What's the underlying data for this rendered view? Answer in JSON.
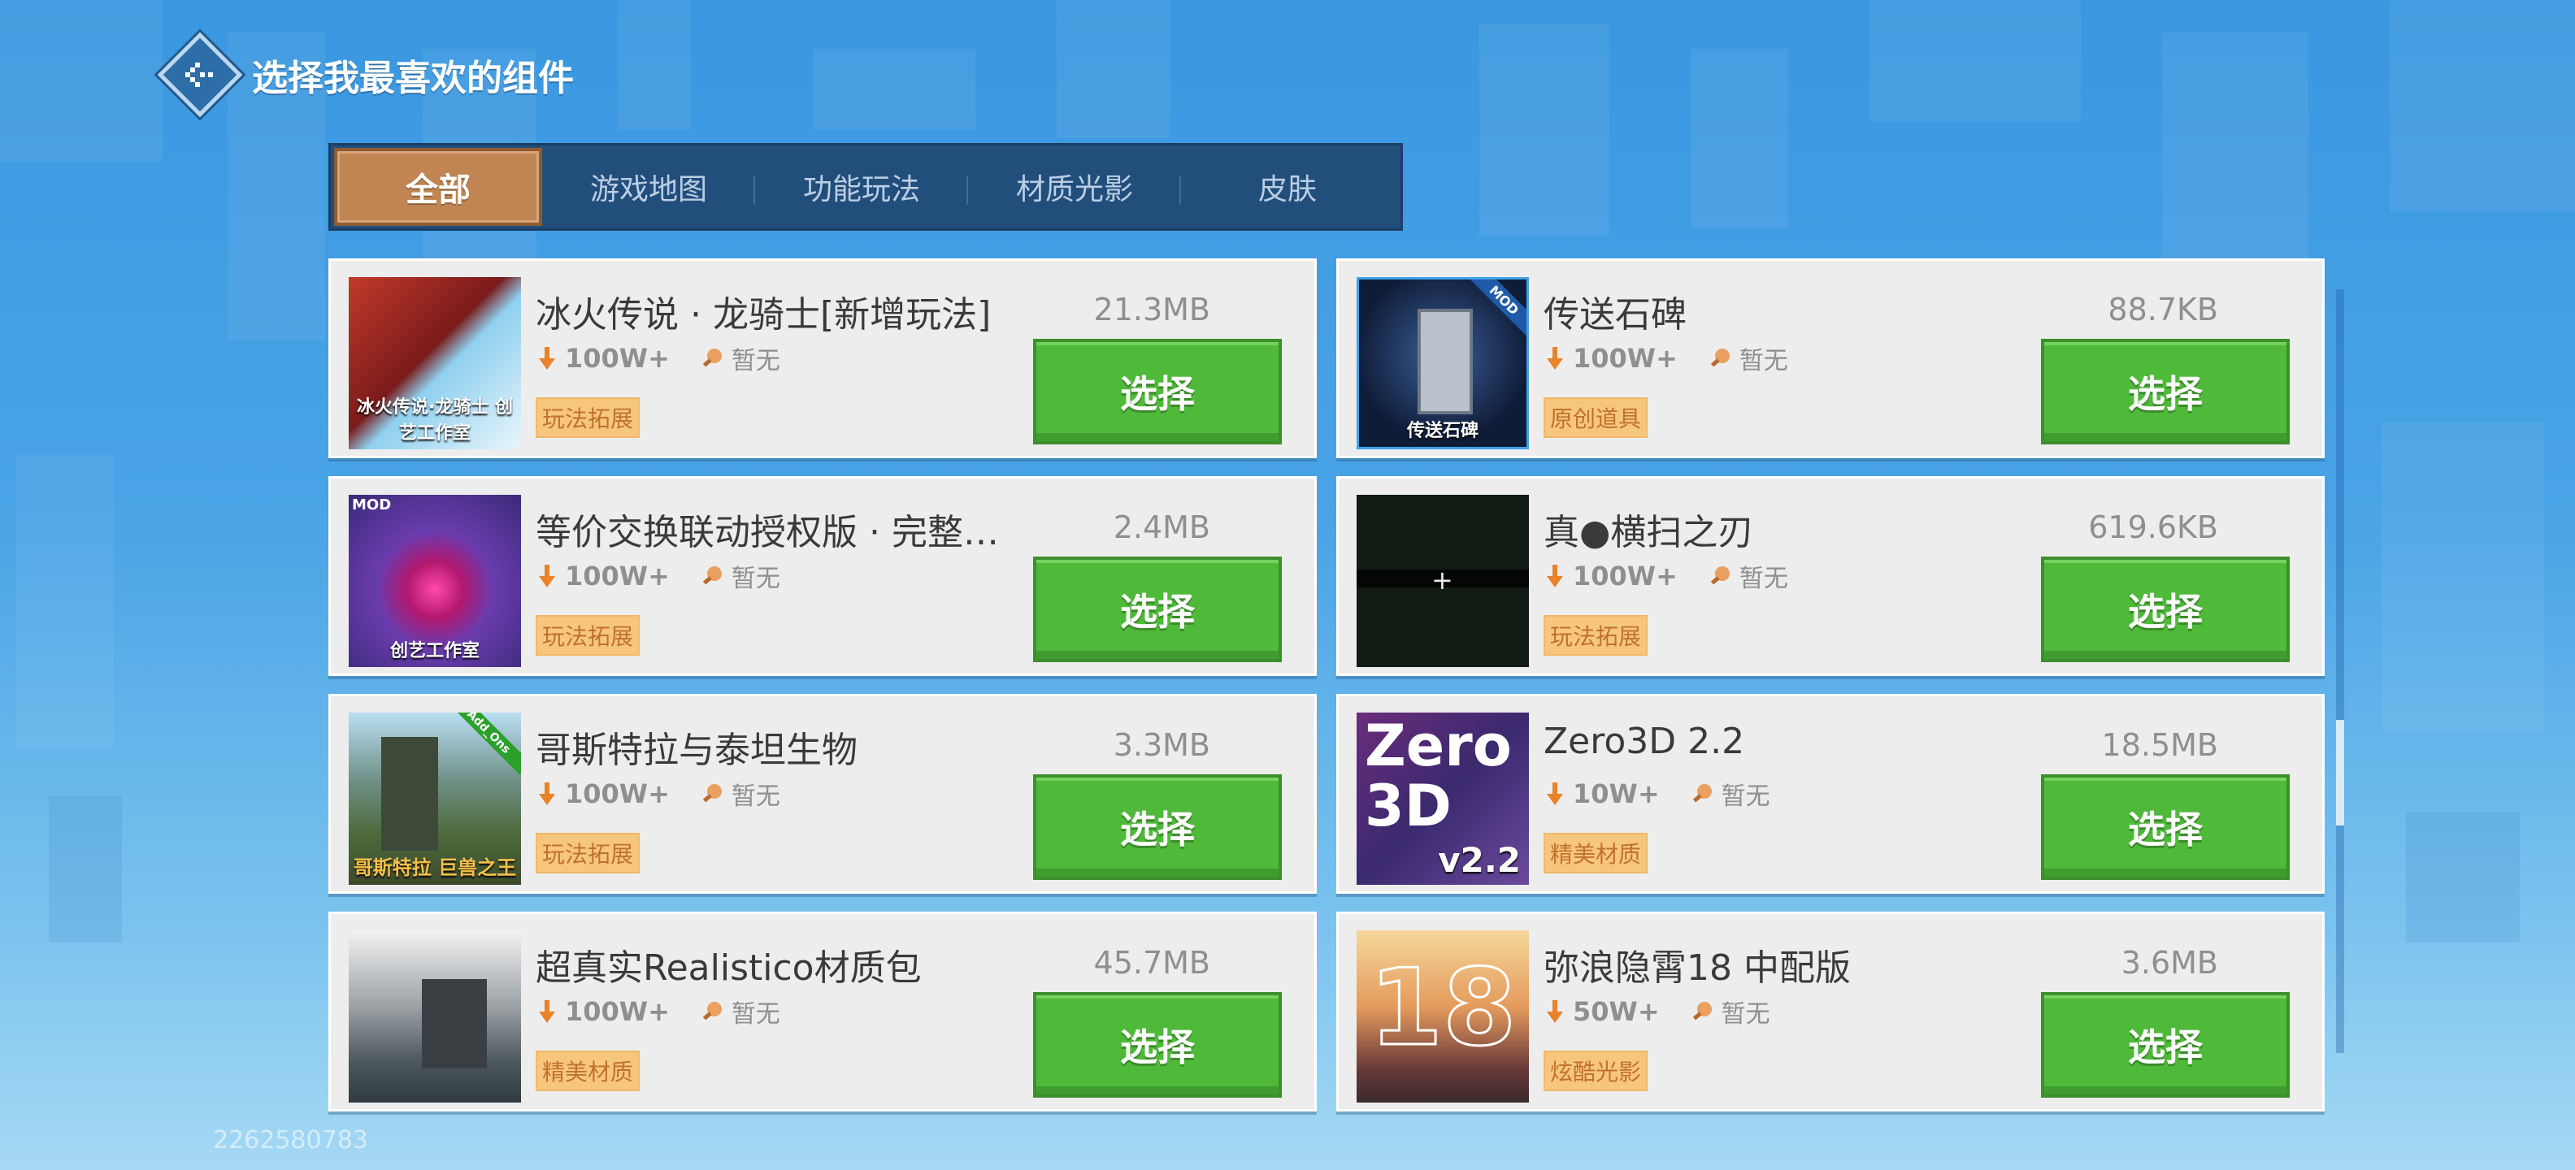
{
  "header": {
    "title": "选择我最喜欢的组件",
    "back_icon": "back-arrow-icon"
  },
  "tabs": [
    {
      "label": "全部",
      "active": true
    },
    {
      "label": "游戏地图",
      "active": false
    },
    {
      "label": "功能玩法",
      "active": false
    },
    {
      "label": "材质光影",
      "active": false
    },
    {
      "label": "皮肤",
      "active": false
    }
  ],
  "items": [
    {
      "name": "冰火传说 · 龙骑士[新增玩法]",
      "downloads": "100W+",
      "rating": "暂无",
      "category": "玩法拓展",
      "size": "21.3MB",
      "button": "选择",
      "thumb_caption": "冰火传说·龙骑士 创艺工作室",
      "badge": ""
    },
    {
      "name": "传送石碑",
      "downloads": "100W+",
      "rating": "暂无",
      "category": "原创道具",
      "size": "88.7KB",
      "button": "选择",
      "thumb_caption": "传送石碑",
      "badge": "MOD"
    },
    {
      "name": "等价交换联动授权版 · 完整…",
      "downloads": "100W+",
      "rating": "暂无",
      "category": "玩法拓展",
      "size": "2.4MB",
      "button": "选择",
      "thumb_caption": "创艺工作室",
      "badge": "MOD"
    },
    {
      "name": "真●横扫之刃",
      "downloads": "100W+",
      "rating": "暂无",
      "category": "玩法拓展",
      "size": "619.6KB",
      "button": "选择",
      "thumb_caption": "",
      "badge": ""
    },
    {
      "name": "哥斯特拉与泰坦生物",
      "downloads": "100W+",
      "rating": "暂无",
      "category": "玩法拓展",
      "size": "3.3MB",
      "button": "选择",
      "thumb_caption": "哥斯特拉 巨兽之王",
      "badge": "Add_Ons"
    },
    {
      "name": "Zero3D 2.2",
      "downloads": "10W+",
      "rating": "暂无",
      "category": "精美材质",
      "size": "18.5MB",
      "button": "选择",
      "thumb_caption": "v2.2",
      "badge": ""
    },
    {
      "name": "超真实Realistico材质包",
      "downloads": "100W+",
      "rating": "暂无",
      "category": "精美材质",
      "size": "45.7MB",
      "button": "选择",
      "thumb_caption": "",
      "badge": ""
    },
    {
      "name": "弥浪隐霄18 中配版",
      "downloads": "50W+",
      "rating": "暂无",
      "category": "炫酷光影",
      "size": "3.6MB",
      "button": "选择",
      "thumb_caption": "18",
      "badge": ""
    }
  ],
  "footer": {
    "id": "2262580783"
  },
  "colors": {
    "background": "#3a97e0",
    "tab_bar": "#224e7c",
    "tab_active": "#c08552",
    "select_button": "#4fb93a",
    "category_tag": "#f7c67e"
  }
}
